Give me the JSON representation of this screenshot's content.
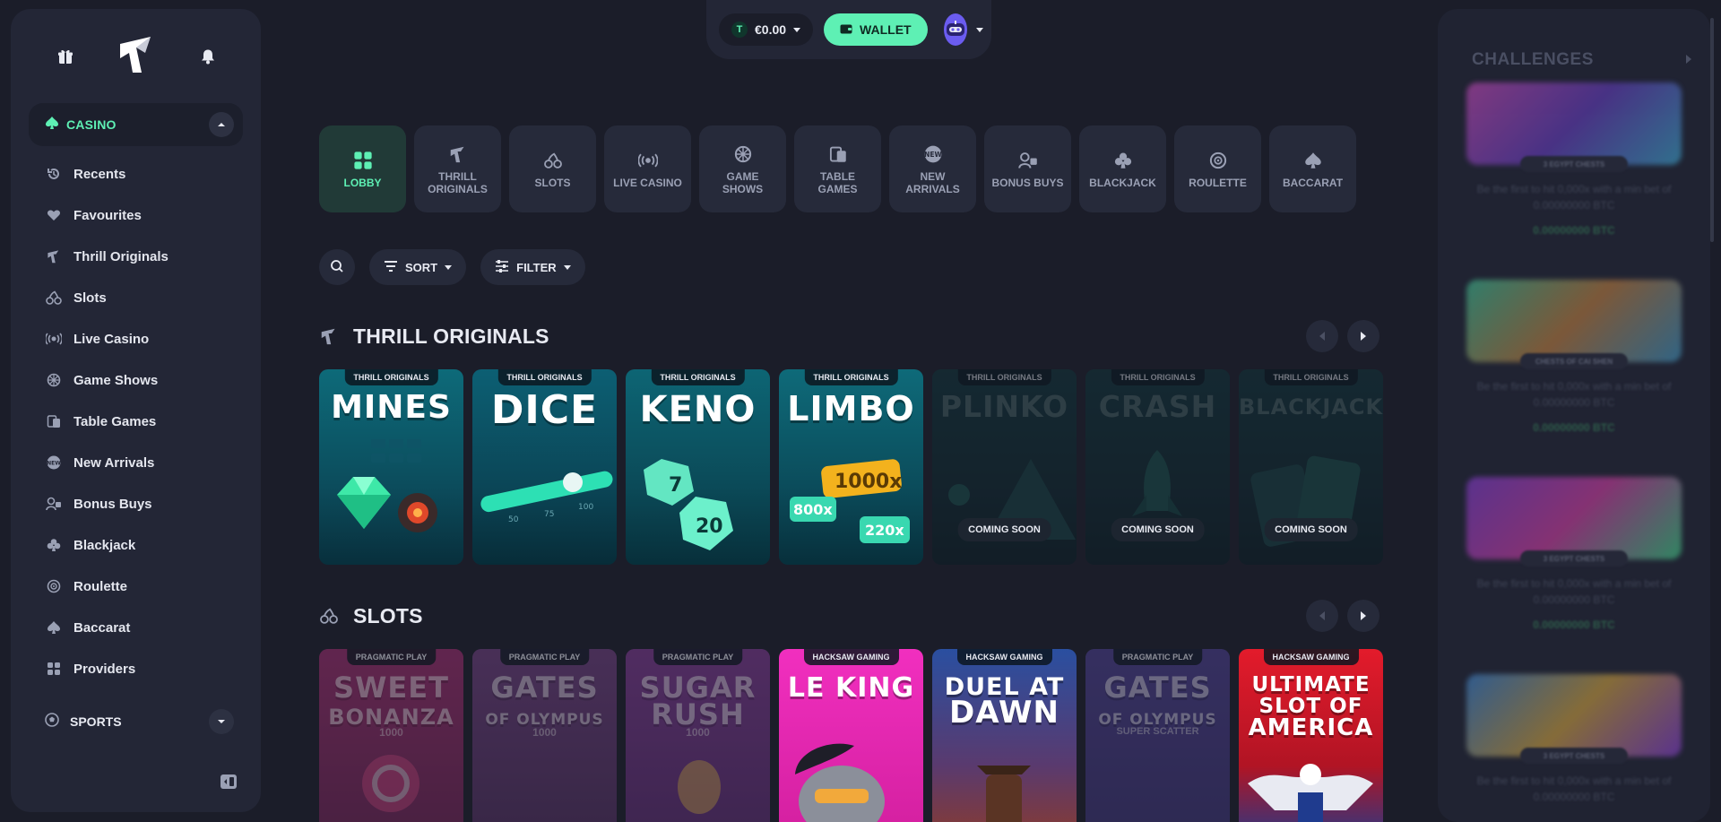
{
  "sidebar": {
    "casino_label": "CASINO",
    "items": [
      {
        "label": "Recents",
        "icon": "history-icon"
      },
      {
        "label": "Favourites",
        "icon": "heart-icon"
      },
      {
        "label": "Thrill Originals",
        "icon": "thrill-logo-icon"
      },
      {
        "label": "Slots",
        "icon": "cherries-icon"
      },
      {
        "label": "Live Casino",
        "icon": "live-icon"
      },
      {
        "label": "Game Shows",
        "icon": "wheel-icon"
      },
      {
        "label": "Table Games",
        "icon": "cards-icon"
      },
      {
        "label": "New Arrivals",
        "icon": "new-badge-icon"
      },
      {
        "label": "Bonus Buys",
        "icon": "bonus-icon"
      },
      {
        "label": "Blackjack",
        "icon": "club-icon"
      },
      {
        "label": "Roulette",
        "icon": "roulette-icon"
      },
      {
        "label": "Baccarat",
        "icon": "spade-icon"
      },
      {
        "label": "Providers",
        "icon": "grid-icon"
      }
    ],
    "sports_label": "SPORTS"
  },
  "topbar": {
    "currency_symbol": "T",
    "balance": "€0.00",
    "wallet_label": "WALLET"
  },
  "categories": [
    {
      "label": "LOBBY",
      "active": true
    },
    {
      "label": "THRILL ORIGINALS"
    },
    {
      "label": "SLOTS"
    },
    {
      "label": "LIVE CASINO"
    },
    {
      "label": "GAME SHOWS"
    },
    {
      "label": "TABLE GAMES"
    },
    {
      "label": "NEW ARRIVALS"
    },
    {
      "label": "BONUS BUYS"
    },
    {
      "label": "BLACKJACK"
    },
    {
      "label": "ROULETTE"
    },
    {
      "label": "BACCARAT"
    }
  ],
  "tools": {
    "sort_label": "SORT",
    "filter_label": "FILTER"
  },
  "originals": {
    "title": "THRILL ORIGINALS",
    "cards": [
      {
        "tag": "THRILL ORIGINALS",
        "name": "MINES"
      },
      {
        "tag": "THRILL ORIGINALS",
        "name": "DICE"
      },
      {
        "tag": "THRILL ORIGINALS",
        "name": "KENO"
      },
      {
        "tag": "THRILL ORIGINALS",
        "name": "LIMBO"
      },
      {
        "tag": "THRILL ORIGINALS",
        "name": "PLINKO",
        "badge": "COMING SOON"
      },
      {
        "tag": "THRILL ORIGINALS",
        "name": "CRASH",
        "badge": "COMING SOON"
      },
      {
        "tag": "THRILL ORIGINALS",
        "name": "BLACKJACK",
        "badge": "COMING SOON"
      }
    ]
  },
  "slots": {
    "title": "SLOTS",
    "cards": [
      {
        "tag": "PRAGMATIC PLAY",
        "name_line1": "SWEET",
        "name_line2": "BONANZA",
        "sub": "1000"
      },
      {
        "tag": "PRAGMATIC PLAY",
        "name_line1": "GATES",
        "name_line2": "OF OLYMPUS",
        "sub": "1000"
      },
      {
        "tag": "PRAGMATIC PLAY",
        "name_line1": "SUGAR",
        "name_line2": "RUSH",
        "sub": "1000"
      },
      {
        "tag": "HACKSAW GAMING",
        "name_line1": "LE KING",
        "name_line2": ""
      },
      {
        "tag": "HACKSAW GAMING",
        "name_line1": "DUEL AT",
        "name_line2": "DAWN"
      },
      {
        "tag": "PRAGMATIC PLAY",
        "name_line1": "GATES",
        "name_line2": "OF OLYMPUS",
        "sub": "SUPER SCATTER"
      },
      {
        "tag": "HACKSAW GAMING",
        "name_line1": "ULTIMATE",
        "name_line2": "SLOT OF",
        "name_line3": "AMERICA"
      }
    ]
  },
  "challenges": {
    "title": "CHALLENGES",
    "cards": [
      {
        "pill": "3 EGYPT CHESTS",
        "desc": "Be the first to hit 0,000x with a min bet of 0.00000000 BTC",
        "reward": "0.00000000 BTC",
        "color": "#8a3fb0"
      },
      {
        "pill": "CHESTS OF CAI SHEN",
        "desc": "Be the first to hit 0,000x with a min bet of 0.00000000 BTC",
        "reward": "0.00000000 BTC",
        "color": "#2f8a6e"
      },
      {
        "pill": "3 EGYPT CHESTS",
        "desc": "Be the first to hit 0,000x with a min bet of 0.00000000 BTC",
        "reward": "0.00000000 BTC",
        "color": "#7a3fb8"
      },
      {
        "pill": "3 EGYPT CHESTS",
        "desc": "Be the first to hit 0,000x with a min bet of 0.00000000 BTC",
        "reward": "",
        "color": "#3a6fb0"
      }
    ]
  },
  "colors": {
    "accent": "#5ef0b4",
    "background": "#1b1d29",
    "panel": "#232636"
  }
}
